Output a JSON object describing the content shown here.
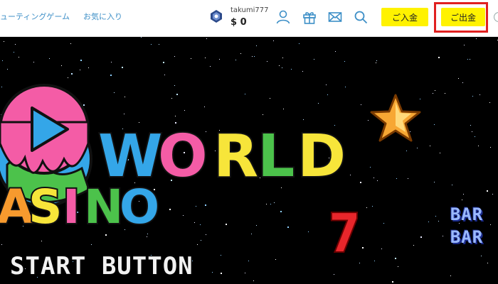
{
  "header": {
    "nav": {
      "shooting": "ューティングゲーム",
      "favorites": "お気に入り"
    },
    "user": {
      "username": "takumi777",
      "balance": "$ 0"
    },
    "icons": [
      "user-icon",
      "gift-icon",
      "mail-icon",
      "search-icon"
    ],
    "deposit_label": "ご入金",
    "withdraw_label": "ご出金"
  },
  "game": {
    "logo": {
      "word1": "WORLD",
      "word2": "ASINO"
    },
    "symbols": {
      "seven": "7",
      "bar_top": "BAR",
      "bar_bottom": "BAR"
    },
    "start_label": "START BUTTON"
  },
  "colors": {
    "accent_link": "#3d8fc7",
    "button_yellow": "#fff200",
    "highlight_red": "#e02020",
    "logo_pink": "#f45ca6",
    "logo_blue": "#34a6e8",
    "logo_yellow": "#f7e53a",
    "logo_green": "#4cc24b",
    "logo_orange": "#f79a2e"
  }
}
